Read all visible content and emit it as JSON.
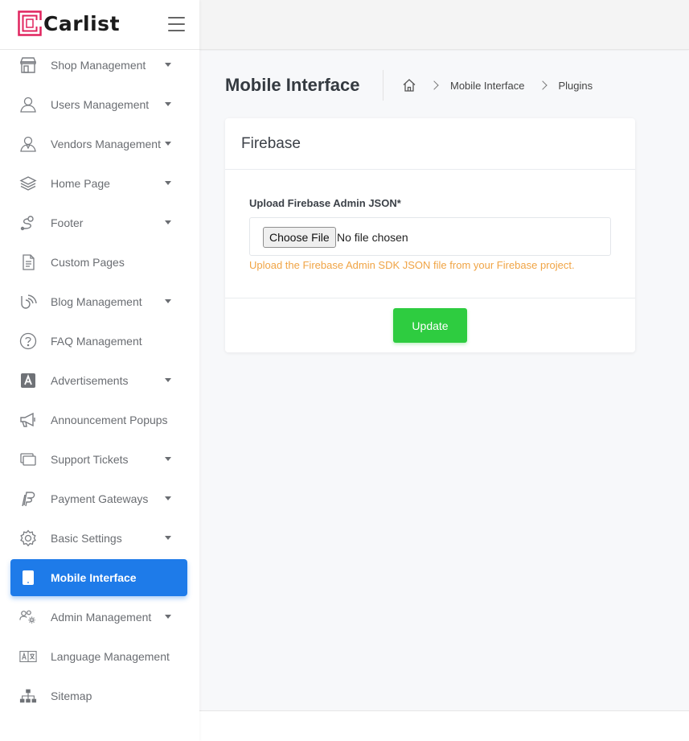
{
  "app": {
    "logo_text": "Carlist",
    "brand_color": "#e0245e"
  },
  "sidebar": {
    "items": [
      {
        "label": "Shop Management",
        "icon": "shop-icon",
        "has_submenu": true
      },
      {
        "label": "Users Management",
        "icon": "users-icon",
        "has_submenu": true
      },
      {
        "label": "Vendors Management",
        "icon": "vendors-icon",
        "has_submenu": true
      },
      {
        "label": "Home Page",
        "icon": "layers-icon",
        "has_submenu": true
      },
      {
        "label": "Footer",
        "icon": "footer-icon",
        "has_submenu": true
      },
      {
        "label": "Custom Pages",
        "icon": "document-icon",
        "has_submenu": false
      },
      {
        "label": "Blog Management",
        "icon": "blog-icon",
        "has_submenu": true
      },
      {
        "label": "FAQ Management",
        "icon": "question-icon",
        "has_submenu": false
      },
      {
        "label": "Advertisements",
        "icon": "ad-icon",
        "has_submenu": true
      },
      {
        "label": "Announcement Popups",
        "icon": "megaphone-icon",
        "has_submenu": false
      },
      {
        "label": "Support Tickets",
        "icon": "tickets-icon",
        "has_submenu": true
      },
      {
        "label": "Payment Gateways",
        "icon": "paypal-icon",
        "has_submenu": true
      },
      {
        "label": "Basic Settings",
        "icon": "gear-icon",
        "has_submenu": true
      },
      {
        "label": "Mobile Interface",
        "icon": "tablet-icon",
        "has_submenu": false,
        "active": true
      },
      {
        "label": "Admin Management",
        "icon": "admin-icon",
        "has_submenu": true
      },
      {
        "label": "Language Management",
        "icon": "language-icon",
        "has_submenu": false
      },
      {
        "label": "Sitemap",
        "icon": "sitemap-icon",
        "has_submenu": false
      }
    ],
    "active_color": "#1e7be9"
  },
  "header": {
    "page_title": "Mobile Interface",
    "breadcrumb": [
      "Mobile Interface",
      "Plugins"
    ]
  },
  "card": {
    "title": "Firebase",
    "field_label": "Upload Firebase Admin JSON*",
    "file_button_label": "Choose File",
    "file_status": "No file chosen",
    "help_text": "Upload the Firebase Admin SDK JSON file from your Firebase project.",
    "submit_label": "Update",
    "submit_color": "#2ecc40",
    "help_color": "#f0a445"
  }
}
